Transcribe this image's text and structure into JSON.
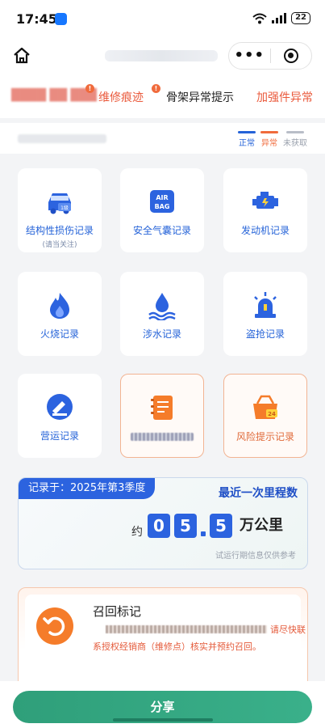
{
  "status_bar": {
    "time": "17:45",
    "battery": "22"
  },
  "nav": {
    "more_label": "•••"
  },
  "tabs": {
    "repair": "维修痕迹",
    "frame": "骨架异常提示",
    "reinforce": "加强件异常",
    "repair_badge": "!",
    "blur_badge": "!"
  },
  "legend": {
    "normal": "正常",
    "abnormal": "异常",
    "unknown": "未获取",
    "colors": {
      "normal": "#2563d8",
      "abnormal": "#f06b3c",
      "unknown": "#b9bec8"
    }
  },
  "cards": [
    {
      "label": "结构性损伤记录",
      "sub": "(请当关注)",
      "icon": "car-damage-icon"
    },
    {
      "label": "安全气囊记录",
      "icon": "airbag-icon",
      "icon_text_top": "AIR",
      "icon_text_bottom": "BAG"
    },
    {
      "label": "发动机记录",
      "icon": "engine-icon"
    },
    {
      "label": "火烧记录",
      "icon": "fire-icon"
    },
    {
      "label": "涉水记录",
      "icon": "water-icon"
    },
    {
      "label": "盗抢记录",
      "icon": "alarm-icon"
    },
    {
      "label": "营运记录",
      "icon": "operation-icon"
    },
    {
      "label": "",
      "icon": "document-icon"
    },
    {
      "label": "风险提示记录",
      "icon": "risk-icon",
      "icon_text": "24"
    }
  ],
  "mileage": {
    "recorded_at": "记录于：2025年第3季度",
    "title": "最近一次里程数",
    "approx": "约",
    "digits": [
      "0",
      "5",
      "5"
    ],
    "unit": "万公里",
    "note": "试运行期信息仅供参考"
  },
  "recall": {
    "title": "召回标记",
    "hint": "请尽快联",
    "desc": "系授权经销商（维修点）核实并预约召回。"
  },
  "share_label": "分享",
  "colors": {
    "primary_blue": "#2c63df",
    "accent_orange": "#f57c2a",
    "share_green": "#2f9f7a"
  }
}
